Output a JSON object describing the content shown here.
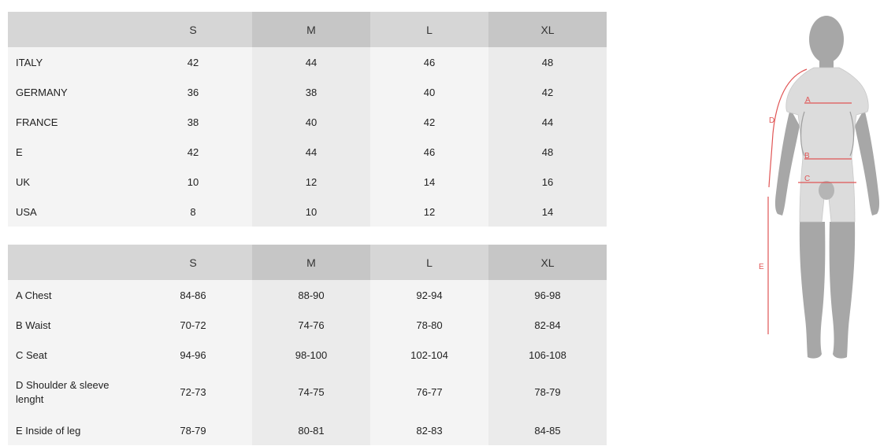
{
  "size_conversion": {
    "headers": [
      "",
      "S",
      "M",
      "L",
      "XL"
    ],
    "rows": [
      {
        "label": "ITALY",
        "values": [
          "42",
          "44",
          "46",
          "48"
        ]
      },
      {
        "label": "GERMANY",
        "values": [
          "36",
          "38",
          "40",
          "42"
        ]
      },
      {
        "label": "FRANCE",
        "values": [
          "38",
          "40",
          "42",
          "44"
        ]
      },
      {
        "label": "E",
        "values": [
          "42",
          "44",
          "46",
          "48"
        ]
      },
      {
        "label": "UK",
        "values": [
          "10",
          "12",
          "14",
          "16"
        ]
      },
      {
        "label": "USA",
        "values": [
          "8",
          "10",
          "12",
          "14"
        ]
      }
    ]
  },
  "measurements": {
    "headers": [
      "",
      "S",
      "M",
      "L",
      "XL"
    ],
    "rows": [
      {
        "label": "A Chest",
        "values": [
          "84-86",
          "88-90",
          "92-94",
          "96-98"
        ]
      },
      {
        "label": "B Waist",
        "values": [
          "70-72",
          "74-76",
          "78-80",
          "82-84"
        ]
      },
      {
        "label": "C Seat",
        "values": [
          "94-96",
          "98-100",
          "102-104",
          "106-108"
        ]
      },
      {
        "label": "D Shoulder & sleeve lenght",
        "values": [
          "72-73",
          "74-75",
          "76-77",
          "78-79"
        ]
      },
      {
        "label": "E Inside of leg",
        "values": [
          "78-79",
          "80-81",
          "82-83",
          "84-85"
        ]
      }
    ]
  },
  "figure": {
    "markers": [
      "A",
      "B",
      "C",
      "D",
      "E"
    ],
    "marker_color": "#e05555",
    "body_color": "#a7a7a7",
    "suit_color": "#dcdcdc"
  },
  "colors": {
    "header_light": "#d6d6d6",
    "header_dark": "#c6c6c6",
    "cell_light": "#f4f4f4",
    "cell_dark": "#ebebeb"
  }
}
